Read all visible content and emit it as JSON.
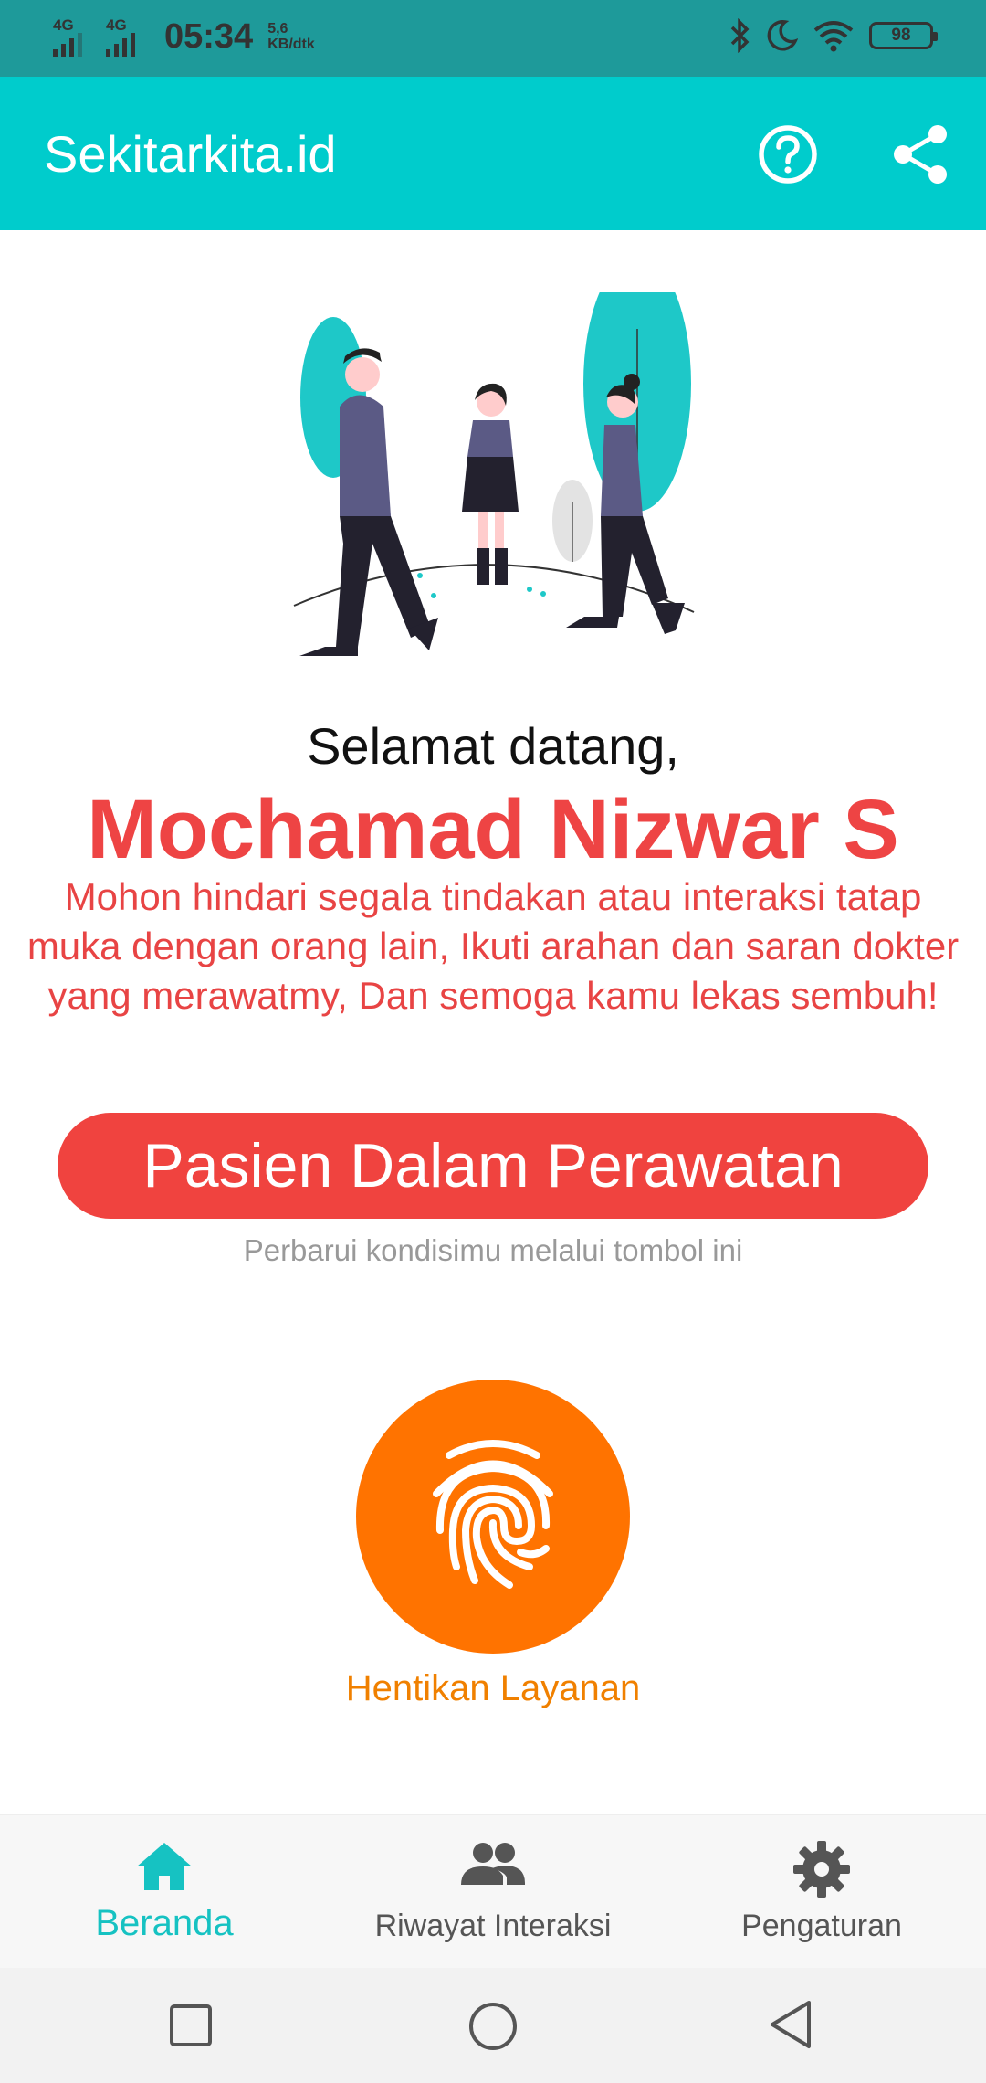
{
  "status_bar": {
    "signal1": "4G",
    "signal2": "4G",
    "time": "05:34",
    "speed_value": "5,6",
    "speed_unit": "KB/dtk",
    "battery": "98",
    "icons": [
      "bluetooth-icon",
      "moon-icon",
      "wifi-icon",
      "battery-icon"
    ]
  },
  "app_bar": {
    "title": "Sekitarkita.id",
    "icons": [
      "help-icon",
      "share-icon"
    ]
  },
  "main": {
    "welcome": "Selamat datang,",
    "user_name": "Mochamad Nizwar S",
    "message": "Mohon hindari segala tindakan atau interaksi tatap muka dengan orang lain, Ikuti arahan dan saran dokter yang merawatmy, Dan semoga kamu lekas sembuh!",
    "status_button": "Pasien Dalam Perawatan",
    "status_hint": "Perbarui kondisimu melalui tombol ini",
    "fingerprint_icon": "fingerprint-icon",
    "stop_label": "Hentikan Layanan"
  },
  "bottom_nav": {
    "items": [
      {
        "label": "Beranda",
        "icon": "home-icon",
        "active": true
      },
      {
        "label": "Riwayat Interaksi",
        "icon": "people-icon",
        "active": false
      },
      {
        "label": "Pengaturan",
        "icon": "gear-icon",
        "active": false
      }
    ]
  },
  "system_nav": [
    "recents-icon",
    "home-circle-icon",
    "back-icon"
  ],
  "colors": {
    "status_bar": "#1e9a9a",
    "app_bar": "#00cccc",
    "accent_red": "#f0433f",
    "orange": "#ff7300",
    "nav_active": "#16c2c2"
  }
}
